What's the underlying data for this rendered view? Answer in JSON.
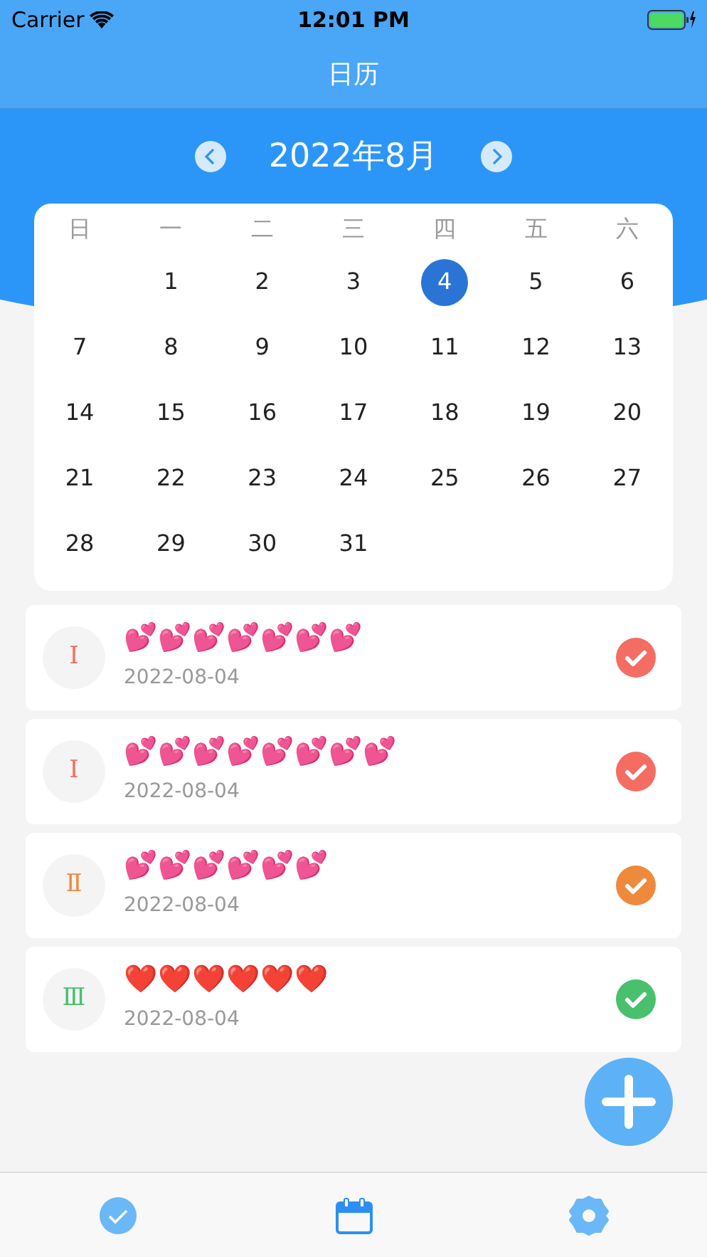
{
  "status_bar": {
    "carrier": "Carrier",
    "time": "12:01 PM"
  },
  "nav_bar": {
    "title": "日历"
  },
  "calendar": {
    "month_title": "2022年8月",
    "weekdays": [
      "日",
      "一",
      "二",
      "三",
      "四",
      "五",
      "六"
    ],
    "weeks": [
      [
        {
          "kind": "blank"
        },
        {
          "kind": "day",
          "day": "1",
          "selected": false
        },
        {
          "kind": "day",
          "day": "2",
          "selected": false
        },
        {
          "kind": "day",
          "day": "3",
          "selected": false
        },
        {
          "kind": "day",
          "day": "4",
          "selected": true
        },
        {
          "kind": "day",
          "day": "5",
          "selected": false
        },
        {
          "kind": "day",
          "day": "6",
          "selected": false
        }
      ],
      [
        {
          "kind": "day",
          "day": "7",
          "selected": false
        },
        {
          "kind": "day",
          "day": "8",
          "selected": false
        },
        {
          "kind": "day",
          "day": "9",
          "selected": false
        },
        {
          "kind": "day",
          "day": "10",
          "selected": false
        },
        {
          "kind": "day",
          "day": "11",
          "selected": false
        },
        {
          "kind": "day",
          "day": "12",
          "selected": false
        },
        {
          "kind": "day",
          "day": "13",
          "selected": false
        }
      ],
      [
        {
          "kind": "day",
          "day": "14",
          "selected": false
        },
        {
          "kind": "day",
          "day": "15",
          "selected": false
        },
        {
          "kind": "day",
          "day": "16",
          "selected": false
        },
        {
          "kind": "day",
          "day": "17",
          "selected": false
        },
        {
          "kind": "day",
          "day": "18",
          "selected": false
        },
        {
          "kind": "day",
          "day": "19",
          "selected": false
        },
        {
          "kind": "day",
          "day": "20",
          "selected": false
        }
      ],
      [
        {
          "kind": "day",
          "day": "21",
          "selected": false
        },
        {
          "kind": "day",
          "day": "22",
          "selected": false
        },
        {
          "kind": "day",
          "day": "23",
          "selected": false
        },
        {
          "kind": "day",
          "day": "24",
          "selected": false
        },
        {
          "kind": "day",
          "day": "25",
          "selected": false
        },
        {
          "kind": "day",
          "day": "26",
          "selected": false
        },
        {
          "kind": "day",
          "day": "27",
          "selected": false
        }
      ],
      [
        {
          "kind": "day",
          "day": "28",
          "selected": false
        },
        {
          "kind": "day",
          "day": "29",
          "selected": false
        },
        {
          "kind": "day",
          "day": "30",
          "selected": false
        },
        {
          "kind": "day",
          "day": "31",
          "selected": false
        },
        {
          "kind": "blank"
        },
        {
          "kind": "blank"
        },
        {
          "kind": "blank"
        }
      ]
    ]
  },
  "entries": [
    {
      "level": "Ⅰ",
      "color": "#f56c62",
      "text": "💕💕💕💕💕💕💕",
      "date": "2022-08-04"
    },
    {
      "level": "Ⅰ",
      "color": "#f56c62",
      "text": "💕💕💕💕💕💕💕💕",
      "date": "2022-08-04"
    },
    {
      "level": "Ⅱ",
      "color": "#ef8a3c",
      "text": "💕💕💕💕💕💕",
      "date": "2022-08-04"
    },
    {
      "level": "Ⅲ",
      "color": "#48c06e",
      "text": "❤️❤️❤️❤️❤️❤️",
      "date": "2022-08-04"
    }
  ],
  "tabs": [
    {
      "kind": "done",
      "selected": false
    },
    {
      "kind": "calendar",
      "selected": true
    },
    {
      "kind": "settings",
      "selected": false
    }
  ]
}
